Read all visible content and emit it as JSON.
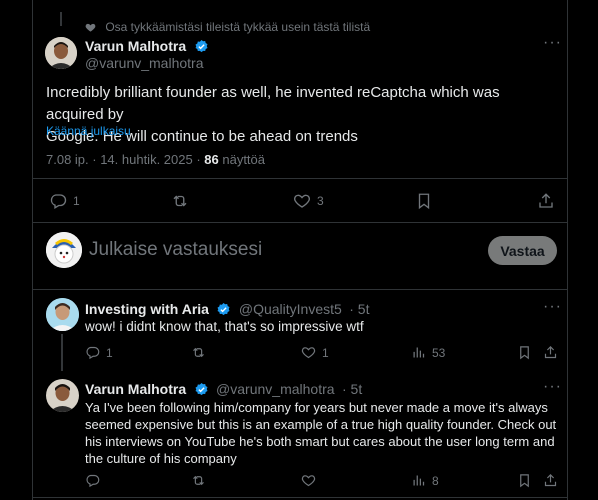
{
  "social_context": "Osa tykkäämistäsi tileistä tykkää usein tästä tilistä",
  "main_post": {
    "author_name": "Varun Malhotra",
    "author_handle": "@varunv_malhotra",
    "text_line1": "Incredibly brilliant founder as well, he invented reCaptcha which was acquired by",
    "text_line2": "Google. He will continue to be ahead on trends",
    "translate_label": "Käännä julkaisu",
    "timestamp": "7.08 ip. · 14. huhtik. 2025 · ",
    "views_count": "86",
    "views_label": " näyttöä",
    "reply_count": "1",
    "like_count": "3"
  },
  "composer": {
    "placeholder": "Julkaise vastauksesi",
    "submit_label": "Vastaa"
  },
  "replies": [
    {
      "author_name": "Investing with Aria",
      "author_handle": "@QualityInvest5",
      "time": "· 5t",
      "text": "wow! i didnt know that, that's so impressive wtf",
      "reply_count": "1",
      "like_count": "1",
      "views": "53"
    },
    {
      "author_name": "Varun Malhotra",
      "author_handle": "@varunv_malhotra",
      "time": "· 5t",
      "text_lines": [
        "Ya I've been following him/company for years but never made a move it's always",
        "seemed expensive but this is an example of a true high quality founder. Check out",
        "his interviews on YouTube he's both smart but cares about the user long term and",
        "the culture of his company"
      ],
      "views": "8"
    }
  ],
  "colors": {
    "background": "#000000",
    "text": "#e7e9ea",
    "muted": "#71767b",
    "accent": "#1d9bf0",
    "border": "#2f3336"
  }
}
